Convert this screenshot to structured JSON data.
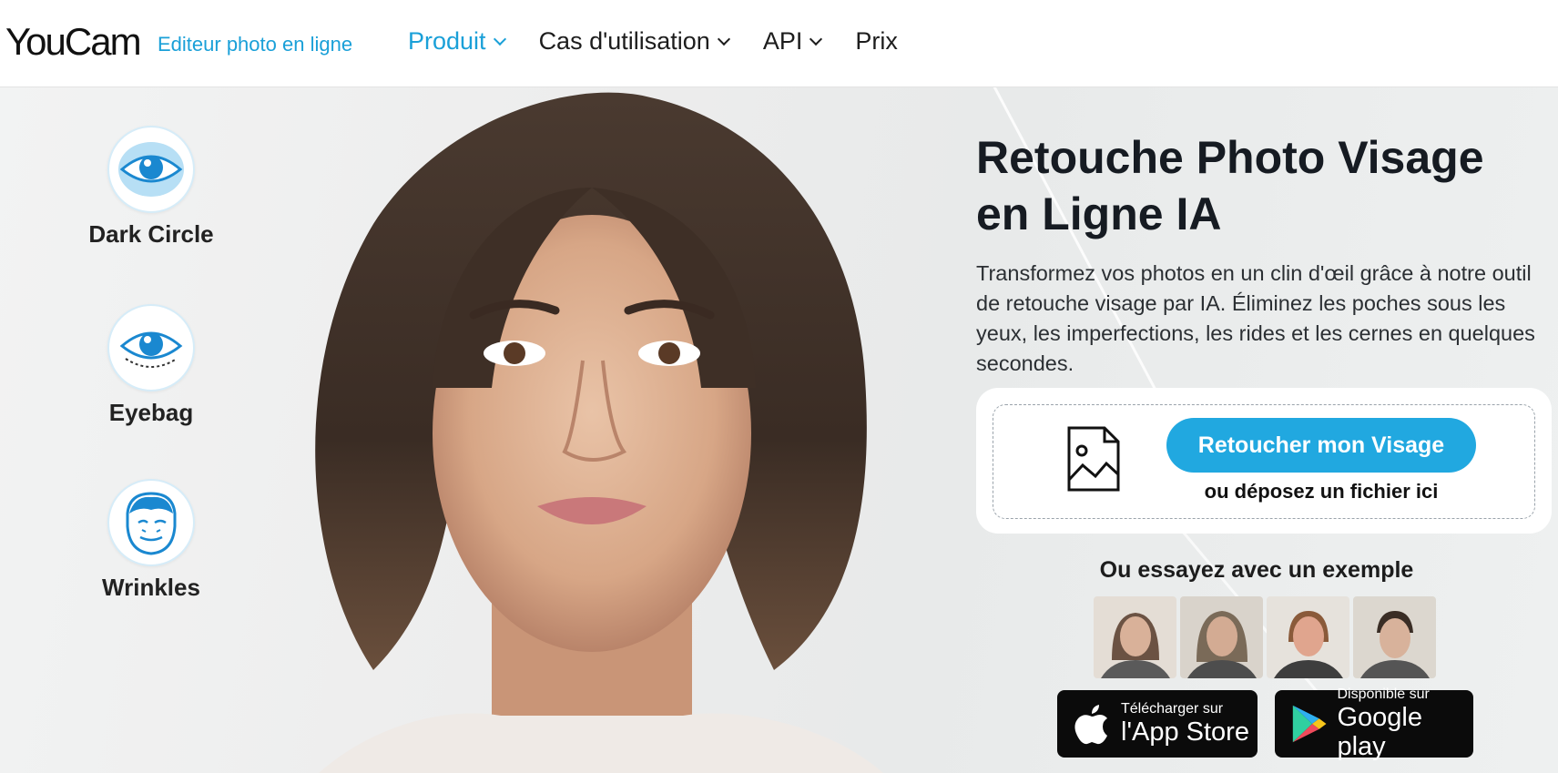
{
  "header": {
    "logo": "YouCam",
    "tagline": "Editeur photo en ligne",
    "nav": [
      {
        "label": "Produit",
        "dropdown": true,
        "active": true
      },
      {
        "label": "Cas d'utilisation",
        "dropdown": true,
        "active": false
      },
      {
        "label": "API",
        "dropdown": true,
        "active": false
      },
      {
        "label": "Prix",
        "dropdown": false,
        "active": false
      }
    ]
  },
  "features": [
    {
      "label": "Dark Circle",
      "icon": "dark-circle-eye-icon"
    },
    {
      "label": "Eyebag",
      "icon": "eyebag-eye-icon"
    },
    {
      "label": "Wrinkles",
      "icon": "wrinkles-face-icon"
    }
  ],
  "hero": {
    "title": "Retouche Photo Visage en Ligne IA",
    "description": "Transformez vos photos en un clin d'œil grâce à notre outil de retouche visage par IA. Éliminez les poches sous les yeux, les imperfections, les rides et les cernes en quelques secondes."
  },
  "upload": {
    "button": "Retoucher mon Visage",
    "hint": "ou déposez un fichier ici"
  },
  "examples": {
    "title": "Ou essayez avec un exemple"
  },
  "stores": {
    "apple": {
      "small": "Télécharger sur",
      "big": "l'App Store"
    },
    "google": {
      "small": "Disponible sur",
      "big": "Google play"
    }
  },
  "colors": {
    "accent": "#1aa0d8",
    "button": "#21a8e0",
    "text_dark": "#161b22"
  }
}
